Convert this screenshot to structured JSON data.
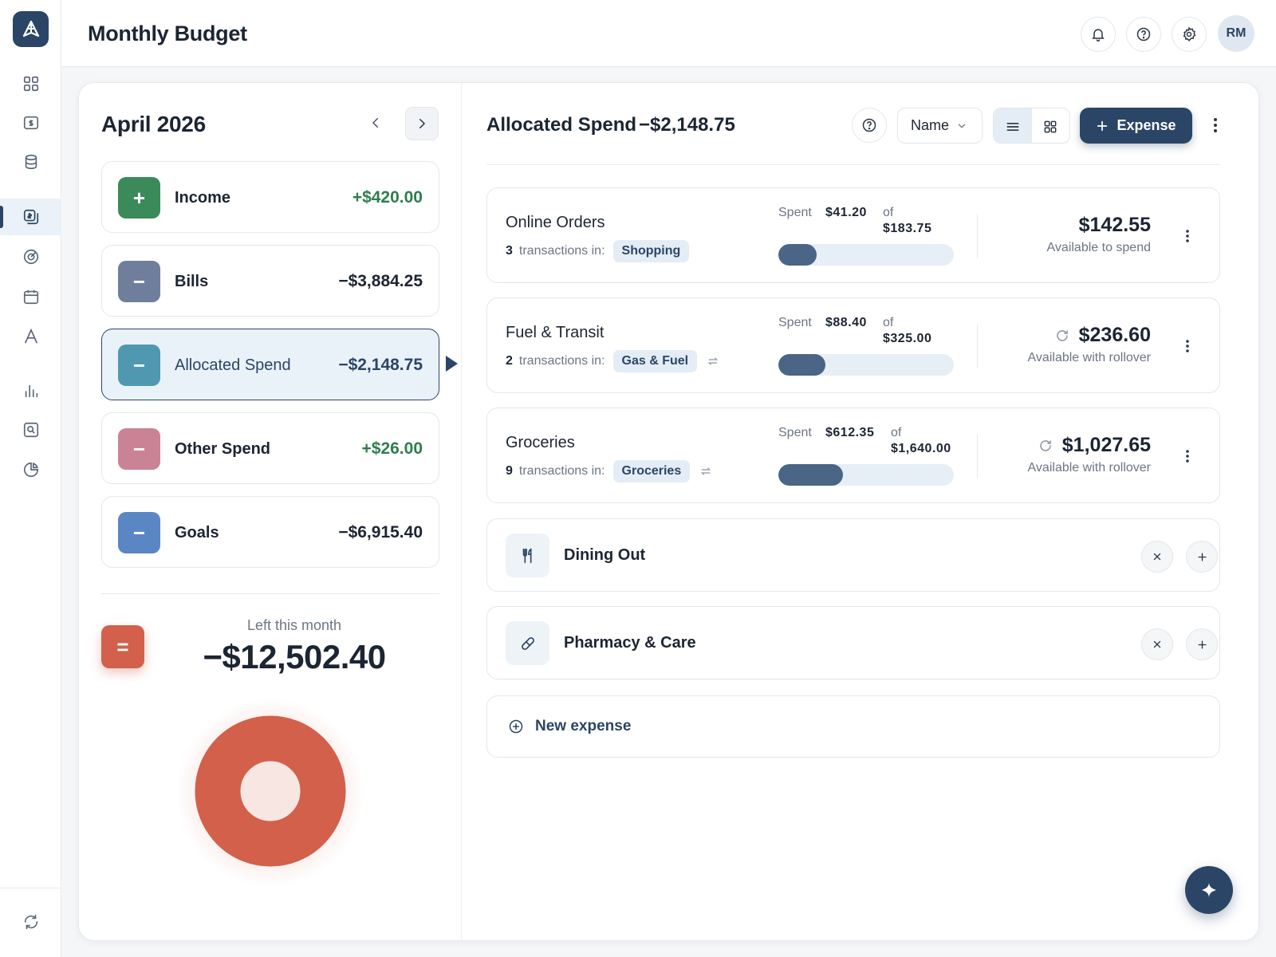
{
  "app": {
    "title": "Monthly Budget",
    "user_initials": "RM"
  },
  "month": {
    "title": "April 2026"
  },
  "categories": [
    {
      "label": "Income",
      "amount": "+$420.00",
      "sign": "+",
      "color": "#3b8a5a"
    },
    {
      "label": "Bills",
      "amount": "−$3,884.25",
      "sign": "−",
      "color": "#6f7e9b"
    },
    {
      "label": "Allocated Spend",
      "amount": "−$2,148.75",
      "sign": "−",
      "color": "#4f98b0"
    },
    {
      "label": "Other Spend",
      "amount": "+$26.00",
      "sign": "−",
      "color": "#c98394"
    },
    {
      "label": "Goals",
      "amount": "−$6,915.40",
      "sign": "−",
      "color": "#5b86c4"
    }
  ],
  "summary": {
    "icon": "=",
    "label": "Left this month",
    "amount": "−$12,502.40",
    "color": "#d2604a"
  },
  "detail": {
    "title": "Allocated Spend",
    "total": "−$2,148.75",
    "sort": "Name",
    "add_label": "Expense"
  },
  "expenses": [
    {
      "name": "Online Orders",
      "count": "3",
      "meta_label": "transactions in:",
      "tag": "Shopping",
      "rollover": false,
      "spent_label": "Spent",
      "spent": "$41.20",
      "of_label": "of",
      "budget": "$183.75",
      "progress": 0.22,
      "available": "$142.55",
      "available_label": "Available to spend"
    },
    {
      "name": "Fuel & Transit",
      "count": "2",
      "meta_label": "transactions in:",
      "tag": "Gas & Fuel",
      "rollover": true,
      "spent_label": "Spent",
      "spent": "$88.40",
      "of_label": "of",
      "budget": "$325.00",
      "progress": 0.27,
      "available": "$236.60",
      "available_label": "Available with rollover"
    },
    {
      "name": "Groceries",
      "count": "9",
      "meta_label": "transactions in:",
      "tag": "Groceries",
      "rollover": true,
      "spent_label": "Spent",
      "spent": "$612.35",
      "of_label": "of",
      "budget": "$1,640.00",
      "progress": 0.37,
      "available": "$1,027.65",
      "available_label": "Available with rollover"
    }
  ],
  "empty_expenses": [
    {
      "name": "Dining Out",
      "icon": "utensils-icon"
    },
    {
      "name": "Pharmacy & Care",
      "icon": "pill-icon"
    }
  ],
  "new_expense_label": "New expense",
  "colors": {
    "accent": "#2b4566",
    "positive": "#2e7d4f",
    "summary": "#d2604a"
  }
}
